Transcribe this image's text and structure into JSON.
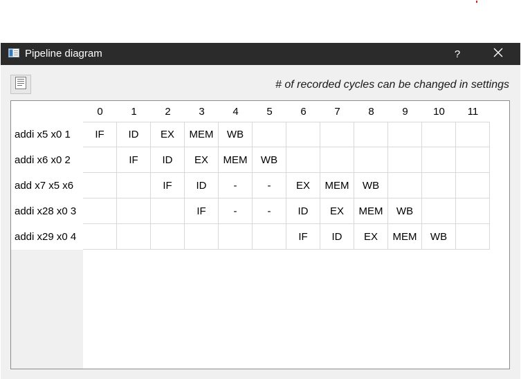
{
  "window": {
    "title": "Pipeline diagram",
    "help_label": "?",
    "icons": {
      "app": "pipeline-app-icon",
      "close": "close-icon",
      "toolbar": "document-icon"
    }
  },
  "hint": "# of recorded cycles can be changed in settings",
  "table": {
    "columns": [
      "0",
      "1",
      "2",
      "3",
      "4",
      "5",
      "6",
      "7",
      "8",
      "9",
      "10",
      "11"
    ],
    "rows": [
      {
        "label": "addi x5 x0 1",
        "cells": [
          "IF",
          "ID",
          "EX",
          "MEM",
          "WB",
          "",
          "",
          "",
          "",
          "",
          "",
          ""
        ]
      },
      {
        "label": "addi x6 x0 2",
        "cells": [
          "",
          "IF",
          "ID",
          "EX",
          "MEM",
          "WB",
          "",
          "",
          "",
          "",
          "",
          ""
        ]
      },
      {
        "label": "add x7 x5 x6",
        "cells": [
          "",
          "",
          "IF",
          "ID",
          "-",
          "-",
          "EX",
          "MEM",
          "WB",
          "",
          "",
          ""
        ]
      },
      {
        "label": "addi x28 x0 3",
        "cells": [
          "",
          "",
          "",
          "IF",
          "-",
          "-",
          "ID",
          "EX",
          "MEM",
          "WB",
          "",
          ""
        ]
      },
      {
        "label": "addi x29 x0 4",
        "cells": [
          "",
          "",
          "",
          "",
          "",
          "",
          "IF",
          "ID",
          "EX",
          "MEM",
          "WB",
          ""
        ]
      }
    ]
  },
  "colors": {
    "titlebar": "#2b2b2b",
    "dialog_bg": "#f0f0f0",
    "grid_line": "#d8d8d8"
  }
}
